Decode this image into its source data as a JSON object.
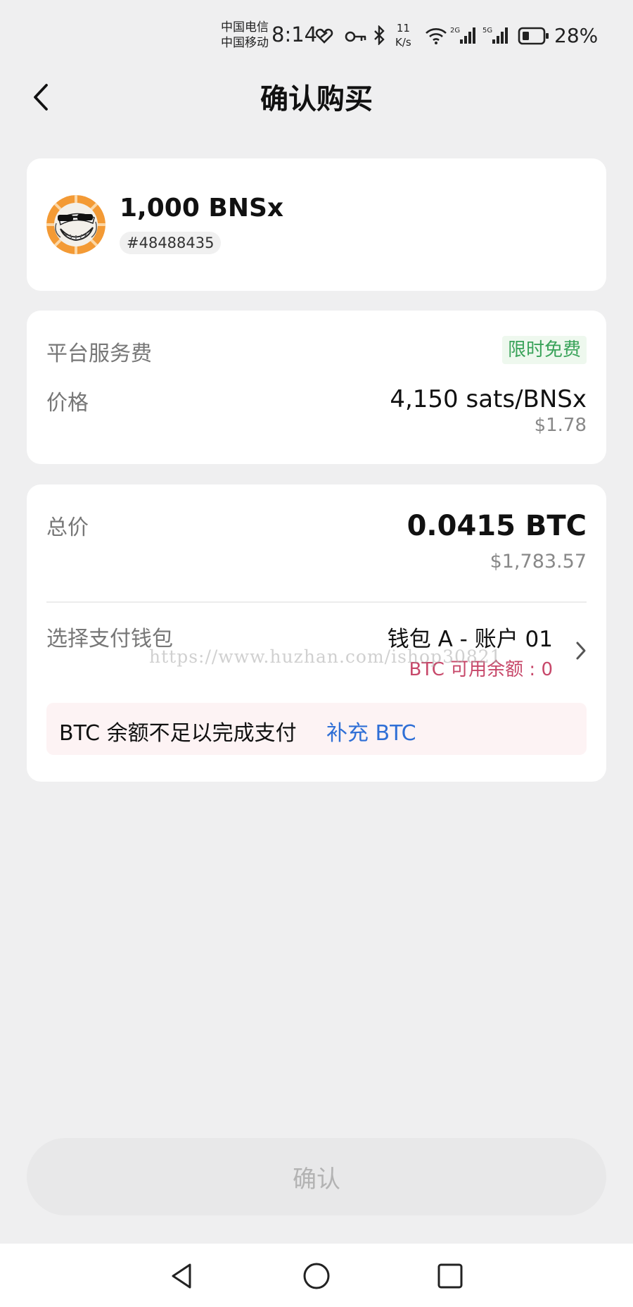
{
  "status_bar": {
    "carrier_1": "中国电信",
    "carrier_2": "中国移动",
    "time": "8:14",
    "net_speed_value": "11",
    "net_speed_unit": "K/s",
    "signal_1": "2G",
    "signal_2": "5G",
    "battery": "28%",
    "icons": [
      "heart-link-icon",
      "key-icon",
      "bluetooth-icon",
      "wifi-icon",
      "signal-icon",
      "signal-icon",
      "battery-icon"
    ]
  },
  "header": {
    "title": "确认购买"
  },
  "token": {
    "amount": "1,000 BNSx",
    "id": "#48488435"
  },
  "fees": {
    "service_fee_label": "平台服务费",
    "service_fee_value": "限时免费",
    "price_label": "价格",
    "price_value": "4,150 sats/BNSx",
    "price_usd": "$1.78"
  },
  "total": {
    "label": "总价",
    "value": "0.0415 BTC",
    "usd": "$1,783.57"
  },
  "wallet": {
    "label": "选择支付钱包",
    "name": "钱包 A - 账户 01",
    "balance": "BTC 可用余额 : 0"
  },
  "warning": {
    "text": "BTC 余额不足以完成支付",
    "link": "补充 BTC"
  },
  "watermark": "https://www.huzhan.com/ishop30821",
  "confirm_button": "确认",
  "colors": {
    "free_green": "#3aa35a",
    "balance_red": "#c7486a",
    "link_blue": "#2f6fd6",
    "background": "#efeff0"
  }
}
